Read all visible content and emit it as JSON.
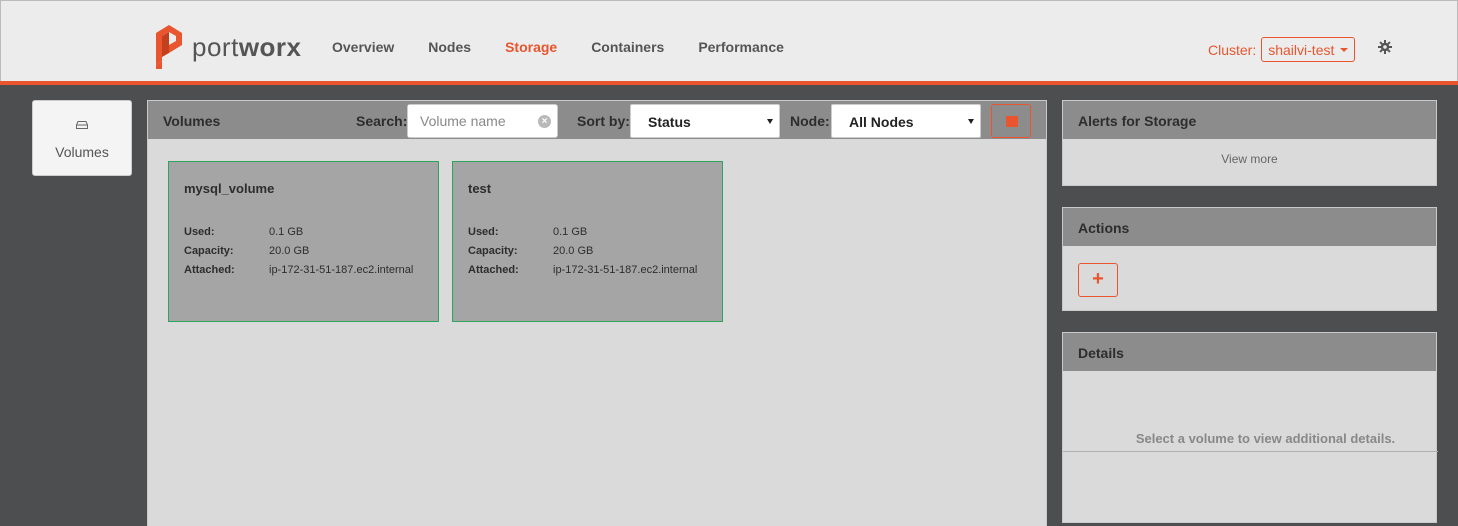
{
  "brand": {
    "logo_light": "port",
    "logo_bold": "worx"
  },
  "nav": [
    {
      "label": "Overview",
      "active": false
    },
    {
      "label": "Nodes",
      "active": false
    },
    {
      "label": "Storage",
      "active": true
    },
    {
      "label": "Containers",
      "active": false
    },
    {
      "label": "Performance",
      "active": false
    }
  ],
  "cluster": {
    "label": "Cluster:",
    "value": "shailvi-test"
  },
  "sidebar": {
    "items": [
      {
        "label": "Volumes",
        "icon": "hdd-icon"
      }
    ]
  },
  "volumes_panel": {
    "title": "Volumes",
    "search_label": "Search:",
    "search_placeholder": "Volume name",
    "sort_label": "Sort by:",
    "sort_value": "Status",
    "node_label": "Node:",
    "node_value": "All Nodes"
  },
  "volumes": [
    {
      "name": "mysql_volume",
      "used_label": "Used:",
      "used": "0.1 GB",
      "capacity_label": "Capacity:",
      "capacity": "20.0 GB",
      "attached_label": "Attached:",
      "attached": "ip-172-31-51-187.ec2.internal"
    },
    {
      "name": "test",
      "used_label": "Used:",
      "used": "0.1 GB",
      "capacity_label": "Capacity:",
      "capacity": "20.0 GB",
      "attached_label": "Attached:",
      "attached": "ip-172-31-51-187.ec2.internal"
    }
  ],
  "alerts": {
    "title": "Alerts for Storage",
    "view_more": "View more"
  },
  "actions": {
    "title": "Actions",
    "add_label": "+"
  },
  "details": {
    "title": "Details",
    "message": "Select a volume to view additional details."
  },
  "colors": {
    "accent": "#e8552e",
    "card_border": "#2da55e",
    "panel_head": "#8c8c8c",
    "background": "#4d4e50"
  }
}
